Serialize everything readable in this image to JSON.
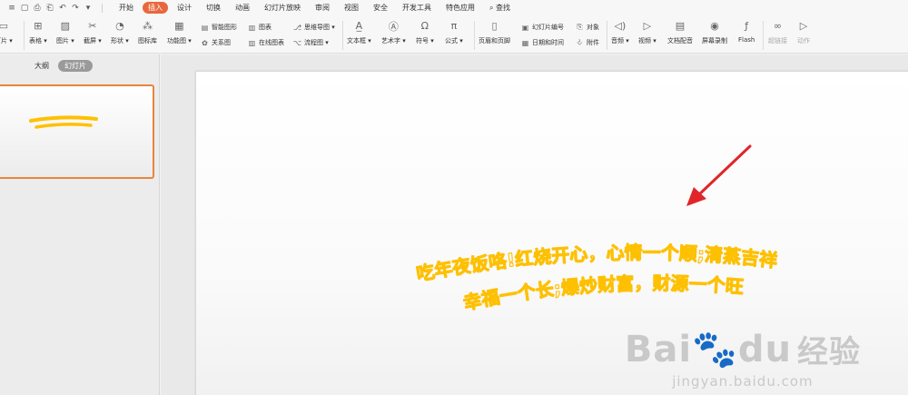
{
  "quick_access": [
    "≡",
    "▢",
    "⎙",
    "⎗",
    "↶",
    "↷",
    "▾"
  ],
  "menu_tabs": [
    {
      "label": "开始",
      "active": false
    },
    {
      "label": "插入",
      "active": true
    },
    {
      "label": "设计",
      "active": false
    },
    {
      "label": "切换",
      "active": false
    },
    {
      "label": "动画",
      "active": false
    },
    {
      "label": "幻灯片放映",
      "active": false
    },
    {
      "label": "审阅",
      "active": false
    },
    {
      "label": "视图",
      "active": false
    },
    {
      "label": "安全",
      "active": false
    },
    {
      "label": "开发工具",
      "active": false
    },
    {
      "label": "特色应用",
      "active": false
    }
  ],
  "search_label": "查找",
  "ribbon": {
    "new_slide": "灯片",
    "table": "表格",
    "picture": "图片",
    "screenshot": "截屏",
    "shape": "形状",
    "icon_lib": "图标库",
    "function_chart": "功能图",
    "smart_graphic": "智能图形",
    "relation_chart": "关系图",
    "chart": "图表",
    "online_chart": "在线图表",
    "mind_map": "思维导图",
    "flow_chart": "流程图",
    "textbox": "文本框",
    "art_text": "艺术字",
    "symbol": "符号",
    "formula": "公式",
    "header_footer": "页眉和页脚",
    "slide_number": "幻灯片编号",
    "object": "对象",
    "date_time": "日期和时间",
    "attachment": "附件",
    "audio": "音频",
    "video": "视频",
    "doc_dub": "文档配音",
    "screen_record": "屏幕录制",
    "flash": "Flash",
    "hyperlink": "超链接",
    "action": "动作"
  },
  "left_panel": {
    "tab_outline": "大纲",
    "tab_slides": "幻灯片"
  },
  "slide": {
    "line1": "吃年夜饭咯!红烧开心，心情一个顺;清蒸吉祥",
    "line2": "幸福一个长;爆炒财富，财源一个旺",
    "text_color": "#ffc000",
    "arrow_color": "#e0262a"
  },
  "watermark": {
    "brand": "Bai",
    "brand2": "du",
    "brand_zh": "经验",
    "url": "jingyan.baidu.com"
  }
}
